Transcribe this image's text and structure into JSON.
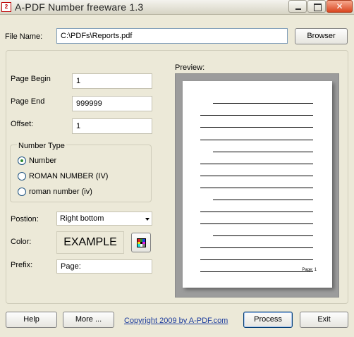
{
  "window": {
    "title": "A-PDF Number freeware 1.3",
    "icon_label": "2"
  },
  "file": {
    "label": "File Name:",
    "value": "C:\\PDFs\\Reports.pdf",
    "browse_label": "Browser"
  },
  "page_begin": {
    "label": "Page Begin",
    "value": "1"
  },
  "page_end": {
    "label": "Page End",
    "value": "999999"
  },
  "offset": {
    "label": "Offset:",
    "value": "1"
  },
  "number_type": {
    "title": "Number Type",
    "options": [
      {
        "label": "Number",
        "checked": true
      },
      {
        "label": "ROMAN NUMBER (IV)",
        "checked": false
      },
      {
        "label": "roman number (iv)",
        "checked": false
      }
    ]
  },
  "position": {
    "label": "Postion:",
    "value": "Right bottom"
  },
  "color": {
    "label": "Color:",
    "example_text": "EXAMPLE"
  },
  "prefix": {
    "label": "Prefix:",
    "value": "Page:"
  },
  "preview": {
    "label": "Preview:",
    "page_number_text": "Page: 1"
  },
  "buttons": {
    "help": "Help",
    "more": "More ...",
    "process": "Process",
    "exit": "Exit"
  },
  "copyright_link": "Copyright 2009 by A-PDF.com",
  "colors": {
    "link": "#1a3a9c",
    "window_bg": "#ece9d8",
    "preview_bg": "#9c9c9c"
  },
  "icons": {
    "color_picker": "palette-icon",
    "dropdown": "chevron-down-icon"
  }
}
